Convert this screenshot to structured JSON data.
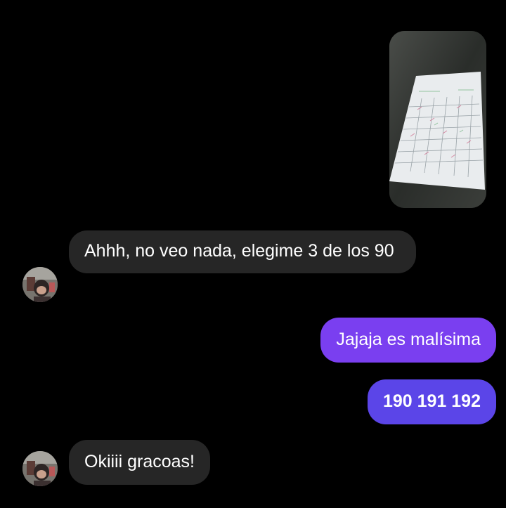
{
  "conversation": {
    "messages": [
      {
        "sender": "contact",
        "type": "photo",
        "description": "photo of a bingo card sheet"
      },
      {
        "sender": "contact",
        "type": "text",
        "text": "Ahhh, no veo nada, elegime 3 de los 90"
      },
      {
        "sender": "me",
        "type": "text",
        "text": "Jajaja es malísima"
      },
      {
        "sender": "me",
        "type": "text",
        "text": "190 191 192"
      },
      {
        "sender": "contact",
        "type": "text",
        "text": "Okiiii gracoas!"
      }
    ]
  },
  "colors": {
    "background": "#000000",
    "incoming_bubble": "#262626",
    "outgoing_bubble_a": "#7a3ff0",
    "outgoing_bubble_b": "#5b45e8"
  }
}
